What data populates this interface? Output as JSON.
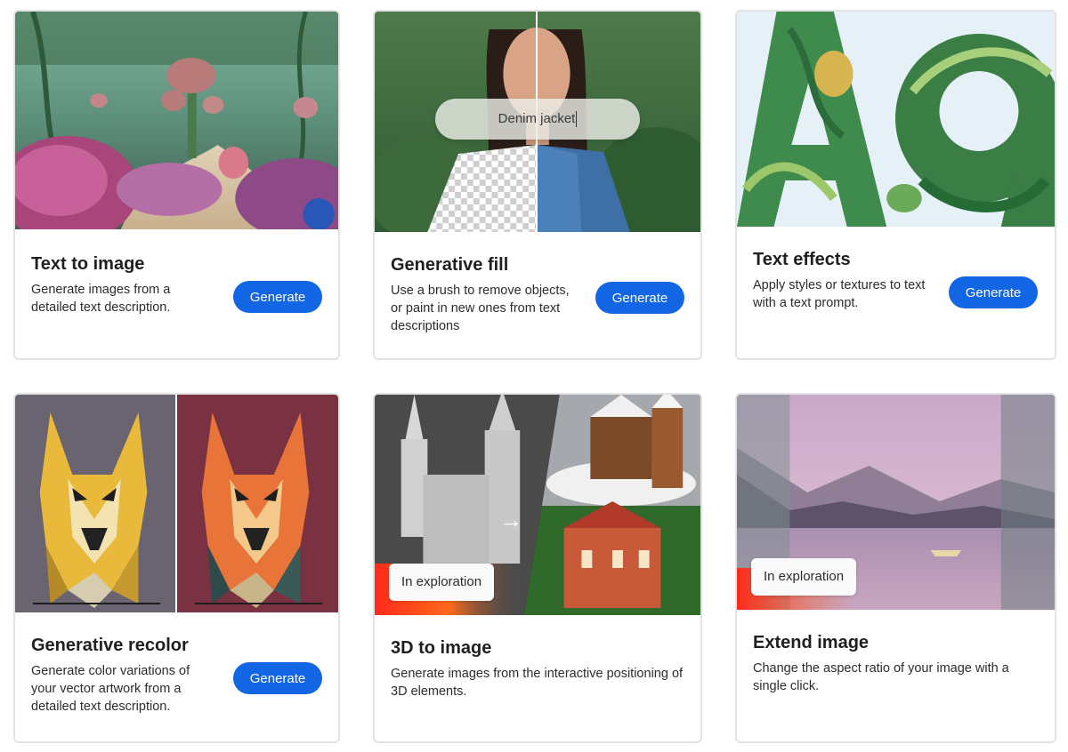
{
  "cards": [
    {
      "title": "Text to image",
      "description": "Generate images from a detailed text description.",
      "button_label": "Generate"
    },
    {
      "title": "Generative fill",
      "description": "Use a brush to remove objects, or paint in new ones from text descriptions",
      "button_label": "Generate",
      "prompt_text": "Denim jacket"
    },
    {
      "title": "Text effects",
      "description": "Apply styles or textures to text with a text prompt.",
      "button_label": "Generate"
    },
    {
      "title": "Generative recolor",
      "description": "Generate color variations of your vector artwork from a detailed text description.",
      "button_label": "Generate"
    },
    {
      "title": "3D to image",
      "description": "Generate images from the interactive positioning of 3D elements.",
      "badge": "In exploration"
    },
    {
      "title": "Extend image",
      "description": "Change the aspect ratio of your image with a single click.",
      "badge": "In exploration"
    }
  ],
  "icons": {
    "card_3d_arrow": "right-arrow-icon"
  },
  "colors": {
    "button": "#1266e3",
    "card_border": "#e3e3e3"
  }
}
